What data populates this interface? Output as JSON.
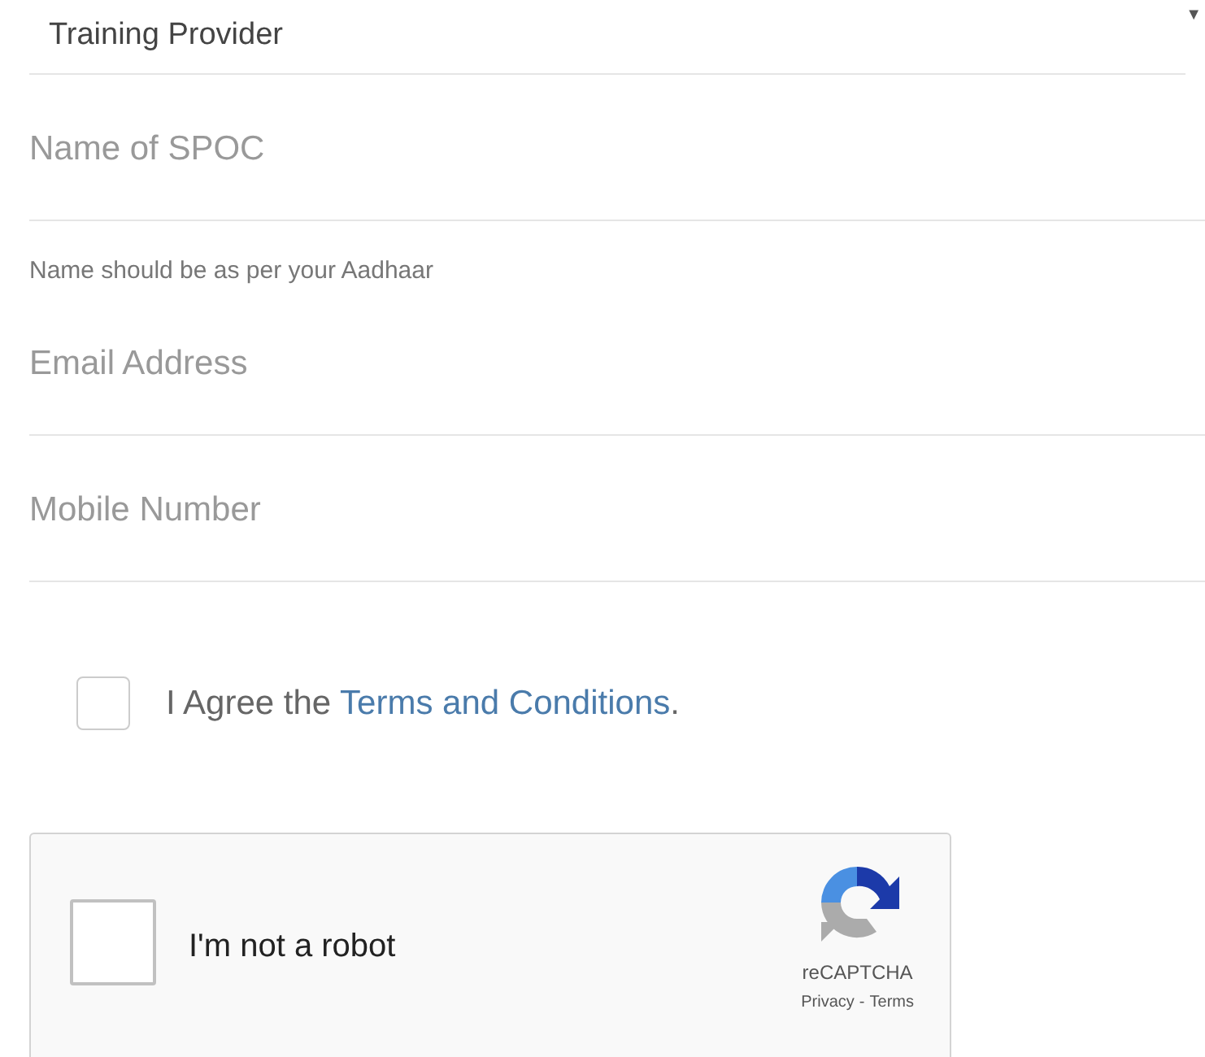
{
  "select": {
    "value": "Training Provider",
    "arrow": "▼"
  },
  "fields": [
    {
      "placeholder": "Name of SPOC",
      "hint": "Name should be as per your Aadhaar"
    },
    {
      "placeholder": "Email Address"
    },
    {
      "placeholder": "Mobile Number"
    }
  ],
  "agree": {
    "checked": false,
    "text": "I Agree the ",
    "link": "Terms and Conditions",
    "after": "."
  },
  "recaptcha": {
    "label": "I'm not a robot",
    "checked": false,
    "brand": "reCAPTCHA",
    "privacy": "Privacy",
    "separator": "-",
    "terms": "Terms"
  }
}
